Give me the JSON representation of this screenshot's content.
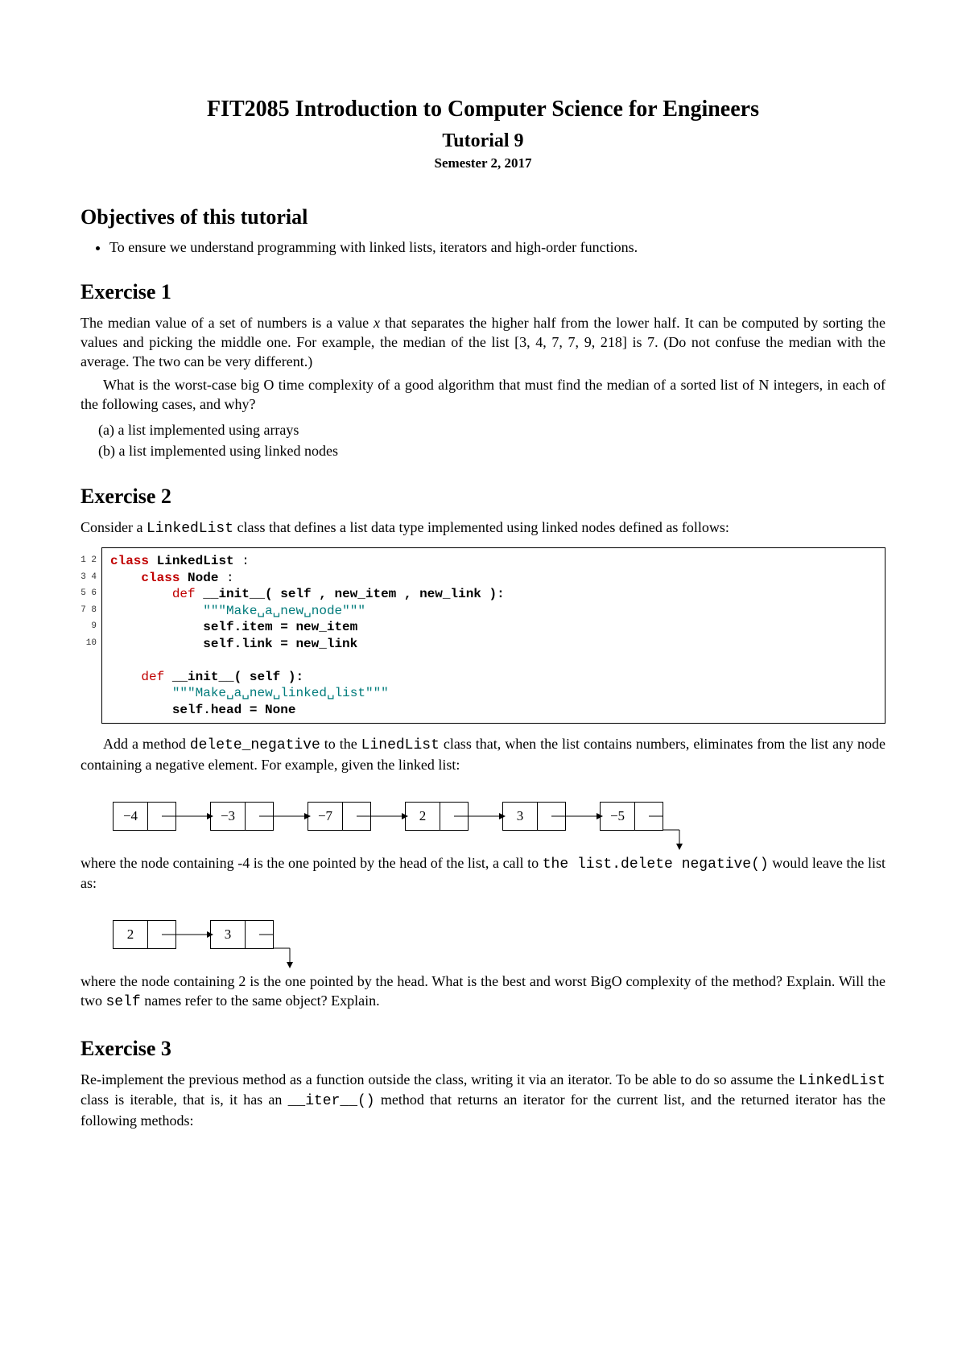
{
  "header": {
    "course": "FIT2085 Introduction to Computer Science for Engineers",
    "tutorial": "Tutorial 9",
    "semester": "Semester 2, 2017"
  },
  "objectives": {
    "heading": "Objectives of this tutorial",
    "bullet1": "To ensure we understand programming with linked lists, iterators and high-order functions."
  },
  "ex1": {
    "heading": "Exercise 1",
    "p1a": "The median value of a set of numbers is a value ",
    "p1b": " that separates the higher half from the lower half. It can be computed by sorting the values and picking the middle one. For example, the median of the list [3, 4, 7, 7, 9, 218] is 7. (Do not confuse the median with the average. The two can be very different.)",
    "p2": "What is the worst-case big O time complexity of a good algorithm that must find the median of a sorted list of N integers, in each of the following cases, and why?",
    "a": "(a) a list implemented using arrays",
    "b": "(b) a list implemented using linked nodes"
  },
  "ex2": {
    "heading": "Exercise 2",
    "intro_a": "Consider a ",
    "intro_b": " class that defines a list data type implemented using linked nodes defined as follows:",
    "code": {
      "tokens": [
        [
          [
            "class",
            "kw-class"
          ],
          [
            " ",
            ""
          ],
          [
            "LinkedList",
            [
              "name-bold"
            ]
          ],
          [
            " :",
            ""
          ]
        ],
        [
          [
            "    ",
            ""
          ],
          [
            "class",
            "kw-class"
          ],
          [
            " ",
            ""
          ],
          [
            "Node",
            [
              "name-bold"
            ]
          ],
          [
            " :",
            ""
          ]
        ],
        [
          [
            "        ",
            ""
          ],
          [
            "def",
            "kw-def"
          ],
          [
            " ",
            ""
          ],
          [
            "__init__",
            [
              "name-bold"
            ]
          ],
          [
            "( self , new_item , new_link ):",
            [
              "name-bold"
            ]
          ]
        ],
        [
          [
            "            ",
            ""
          ],
          [
            "\"\"\"Make␣a␣new␣node\"\"\"",
            "str"
          ]
        ],
        [
          [
            "            ",
            ""
          ],
          [
            "self.item = new_item",
            [
              "name-bold"
            ]
          ]
        ],
        [
          [
            "            ",
            ""
          ],
          [
            "self.link = new_link",
            [
              "name-bold"
            ]
          ]
        ],
        [
          [
            "",
            ""
          ]
        ],
        [
          [
            "    ",
            ""
          ],
          [
            "def",
            "kw-def"
          ],
          [
            " ",
            ""
          ],
          [
            "__init__",
            [
              "name-bold"
            ]
          ],
          [
            "( self ):",
            [
              "name-bold"
            ]
          ]
        ],
        [
          [
            "        ",
            ""
          ],
          [
            "\"\"\"Make␣a␣new␣linked␣list\"\"\"",
            "str"
          ]
        ],
        [
          [
            "        ",
            ""
          ],
          [
            "self.head = None",
            [
              "name-bold"
            ]
          ]
        ]
      ]
    },
    "after1_a": "Add a method ",
    "after1_b": " to the ",
    "after1_c": " class that, when the list contains numbers, eliminates from the list any node containing a negative element. For example, given the linked list:",
    "list1": [
      "−4",
      "−3",
      "−7",
      "2",
      "3",
      "−5"
    ],
    "mid_a": "where the node containing -4 is the one pointed by the head of the list, a call to ",
    "mid_b": " would leave the list as:",
    "list2": [
      "2",
      "3"
    ],
    "after2_a": "where the node containing 2 is the one pointed by the head. What is the best and worst BigO complexity of the method? Explain. Will the two ",
    "after2_b": " names refer to the same object? Explain.",
    "tt_linkedlist": "LinkedList",
    "tt_deleteneg": "delete_negative",
    "tt_linedlist": "LinedList",
    "tt_call": "the list.delete negative()",
    "tt_self": "self"
  },
  "ex3": {
    "heading": "Exercise 3",
    "p_a": "Re-implement the previous method as a function outside the class, writing it via an iterator. To be able to do so assume the ",
    "p_b": " class is iterable, that is, it has an ",
    "p_c": " method that returns an iterator for the current list, and the returned iterator has the following methods:",
    "tt_linkedlist": "LinkedList",
    "tt_iter": "__iter__()"
  }
}
